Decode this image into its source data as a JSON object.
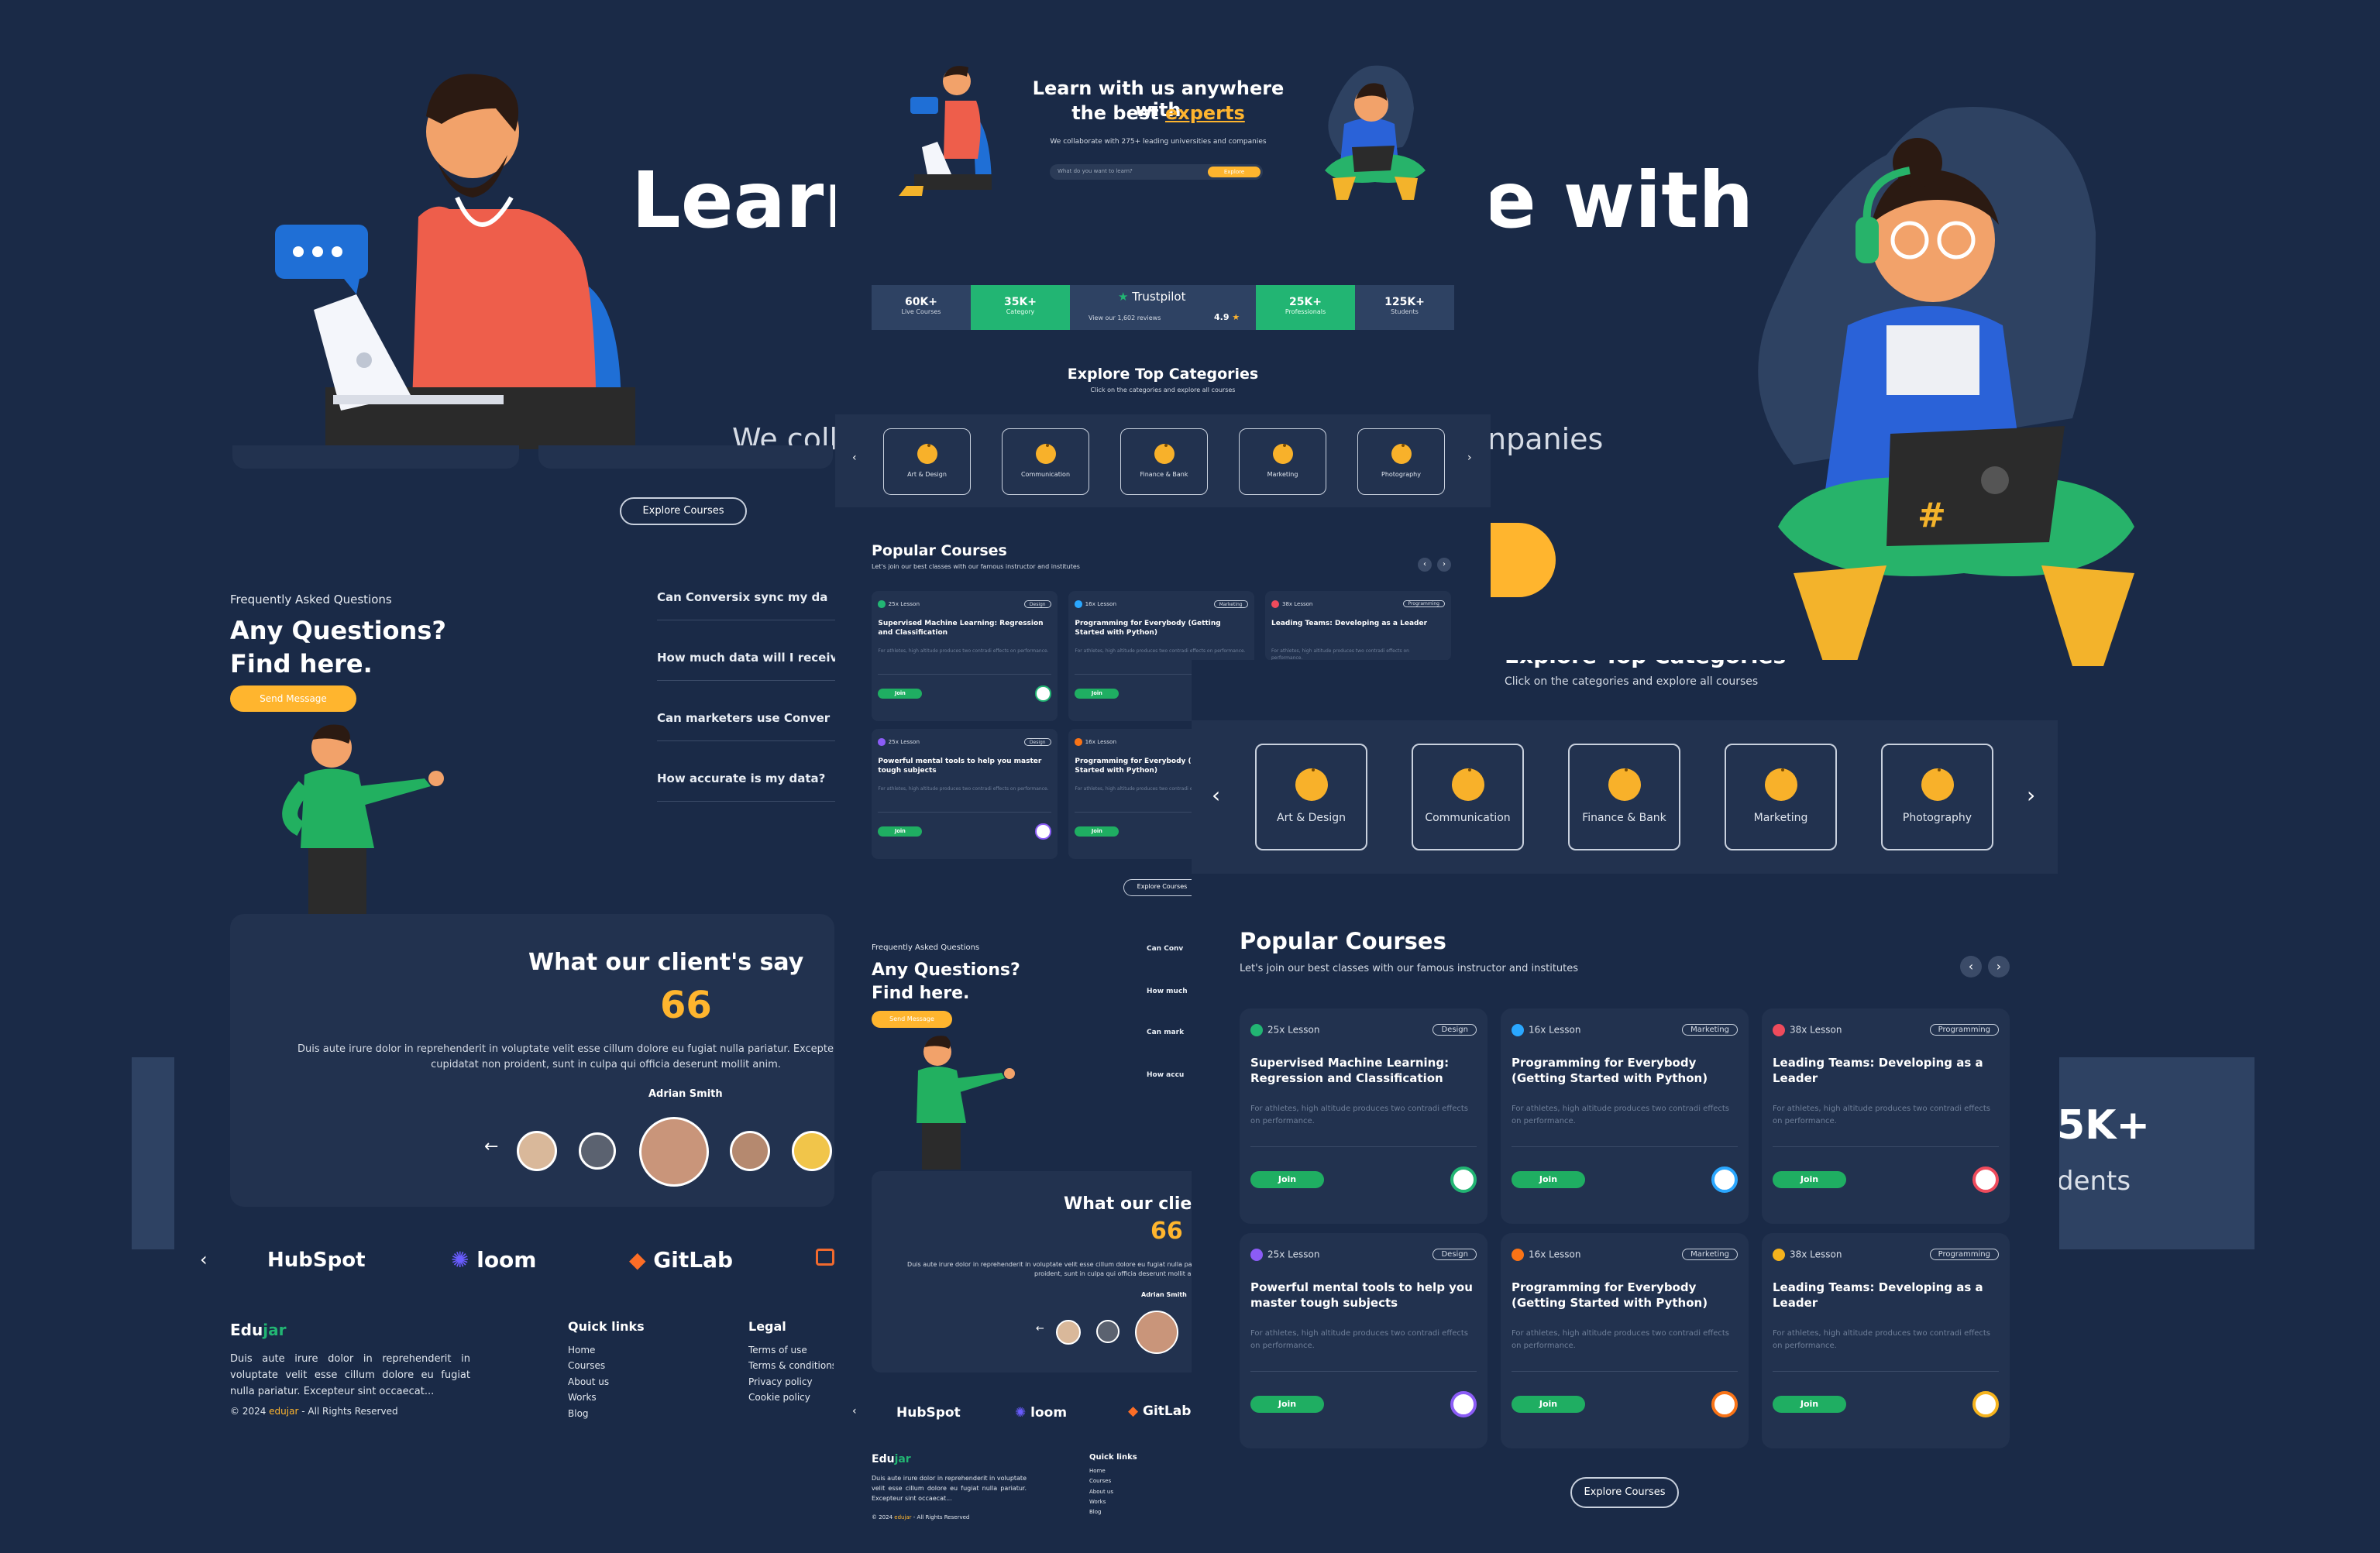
{
  "hero": {
    "title_big_left": "Learn",
    "title_big_right": "e with",
    "subtitle_left": "We coll",
    "subtitle_right": "npanies",
    "title_line1": "Learn with us anywhere with",
    "title_line2_prefix": "the best ",
    "title_line2_highlight": "experts",
    "subtitle": "We collaborate with 275+ leading universities and companies",
    "search_placeholder": "What do you want to learn?",
    "search_button": "Explore"
  },
  "stats": {
    "items": [
      {
        "value": "60K+",
        "label": "Live Courses"
      },
      {
        "value": "35K+",
        "label": "Category"
      },
      {
        "value": "25K+",
        "label": "Professionals"
      },
      {
        "value": "125K+",
        "label": "Students"
      }
    ],
    "trustpilot": {
      "name": "Trustpilot",
      "reviews": "View our 1,602 reviews",
      "rating": "4.9"
    },
    "big_right_value": "5K+",
    "big_right_label": "dents"
  },
  "categories": {
    "title": "Explore Top Categories",
    "title_partial": "Explore Top Categories",
    "subtitle": "Click on the categories and explore all courses",
    "items": [
      {
        "label": "Art & Design",
        "icon": "art-icon"
      },
      {
        "label": "Communication",
        "icon": "chat-icon"
      },
      {
        "label": "Finance & Bank",
        "icon": "finance-icon"
      },
      {
        "label": "Marketing",
        "icon": "marketing-icon"
      },
      {
        "label": "Photography",
        "icon": "camera-icon"
      }
    ]
  },
  "popular": {
    "title": "Popular Courses",
    "subtitle": "Let's join our best classes with our famous instructor and institutes",
    "join_label": "Join",
    "explore_label": "Explore Courses",
    "desc": "For athletes, high altitude produces two contradi effects on performance.",
    "courses": [
      {
        "lessons": "25x Lesson",
        "tag": "Design",
        "title": "Supervised Machine Learning: Regression and Classification",
        "dot": "#22b573"
      },
      {
        "lessons": "16x Lesson",
        "tag": "Marketing",
        "title": "Programming for Everybody (Getting Started with Python)",
        "dot": "#2aa7ff"
      },
      {
        "lessons": "38x Lesson",
        "tag": "Programming",
        "title": "Leading Teams: Developing as a Leader",
        "dot": "#ef4b5c"
      },
      {
        "lessons": "25x Lesson",
        "tag": "Design",
        "title": "Powerful mental tools to help you master tough subjects",
        "dot": "#8b5cf6"
      },
      {
        "lessons": "16x Lesson",
        "tag": "Marketing",
        "title": "Programming for Everybody (Getting Started with Python)",
        "dot": "#f97316"
      },
      {
        "lessons": "38x Lesson",
        "tag": "Programming",
        "title": "Leading Teams: Developing as a Leader",
        "dot": "#f5b31d"
      }
    ]
  },
  "faq": {
    "eyebrow": "Frequently Asked Questions",
    "title_line1": "Any Questions?",
    "title_line2": "Find here.",
    "button": "Send Message",
    "questions": [
      "Can Conversix sync my da",
      "How much data will I receiv",
      "Can marketers use Conver",
      "How accurate is my data?"
    ],
    "questions_small": [
      "Can Conv",
      "How much",
      "Can mark",
      "How accu"
    ]
  },
  "testimonial": {
    "title": "What our client's say",
    "title_small": "What our clie",
    "quote_mark": "66",
    "text": "Duis aute irure dolor in reprehenderit in voluptate velit esse cillum dolore eu fugiat nulla pariatur. Excepteur sint occaecat cupidatat non proident, sunt in culpa qui officia deserunt mollit anim.",
    "author": "Adrian Smith"
  },
  "partners": [
    "HubSpot",
    "loom",
    "GitLab"
  ],
  "footer": {
    "brand_prefix": "Edu",
    "brand_suffix": "jar",
    "text": "Duis aute irure dolor in reprehenderit in voluptate velit esse cillum dolore eu fugiat nulla pariatur. Excepteur sint occaecat...",
    "copyright_prefix": "© 2024 ",
    "copyright_brand": "edujar",
    "copyright_suffix": " - All Rights Reserved",
    "quick_title": "Quick links",
    "quick": [
      "Home",
      "Courses",
      "About us",
      "Works",
      "Blog"
    ],
    "legal_title": "Legal",
    "legal": [
      "Terms of use",
      "Terms & conditions",
      "Privacy policy",
      "Cookie policy"
    ]
  },
  "colors": {
    "bg": "#1a2a47",
    "accent_green": "#22b573",
    "accent_yellow": "#ffb52e"
  }
}
